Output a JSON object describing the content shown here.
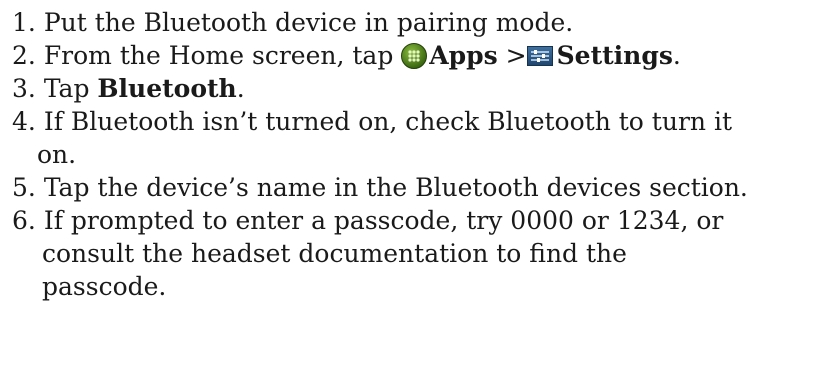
{
  "steps": [
    {
      "num": "1.",
      "text": "Put the Bluetooth device in pairing mode."
    },
    {
      "num": "2.",
      "pre": "From the Home screen, tap ",
      "apps": "Apps",
      "sep": " >",
      "settings": "Settings",
      "post": "."
    },
    {
      "num": "3.",
      "pre": "Tap ",
      "bold": "Bluetooth",
      "post": "."
    },
    {
      "num": "4.",
      "line1": "If Bluetooth isn’t turned on, check Bluetooth to turn it",
      "line2": "on."
    },
    {
      "num": "5.",
      "text": "Tap the device’s name in the Bluetooth devices section."
    },
    {
      "num": "6.",
      "line1": "If prompted to enter a passcode, try 0000 or 1234, or",
      "line2": "consult the headset documentation to find the",
      "line3": "passcode."
    }
  ],
  "icons": {
    "apps": "apps-grid-icon",
    "settings": "settings-sliders-icon"
  }
}
